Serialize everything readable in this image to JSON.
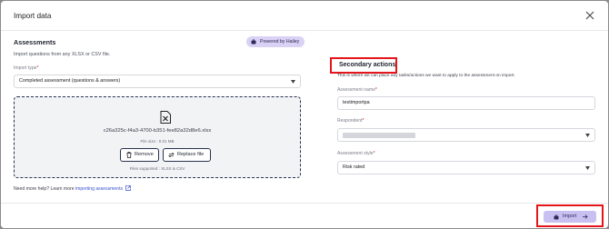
{
  "dialog": {
    "title": "Import data"
  },
  "assessments": {
    "title": "Assessments",
    "badge": "Powered by Hailey",
    "subtitle": "Import questions from any XLSX or CSV file.",
    "import_type_label": "Import type",
    "import_type_value": "Completed assessment (questions & answers)",
    "file": {
      "name": "c26a325c-f4a3-4700-b351-fee82a32d8e6.xlsx",
      "size": "File size : 0.01 MB",
      "remove_label": "Remove",
      "replace_label": "Replace file",
      "supported": "Files supported : XLSX & CSV"
    },
    "help_prefix": "Need more help? Learn more",
    "help_link": "importing assessments"
  },
  "secondary": {
    "title": "Secondary actions",
    "description": "This is where we can place any tasks/actions we want to apply to the assessment on import.",
    "assessment_name_label": "Assessment name",
    "assessment_name_value": "testimportpa",
    "respondent_label": "Respondent",
    "assessment_style_label": "Assessment style",
    "assessment_style_value": "Risk rated"
  },
  "footer": {
    "import_label": "Import"
  },
  "icons": {
    "close": "close-icon",
    "hailey": "hailey-icon",
    "file": "xlsx-file-icon",
    "remove": "trash-icon",
    "replace": "swap-icon",
    "external": "external-link-icon",
    "import": "import-icon",
    "import_arrow": "arrow-right-icon"
  },
  "colors": {
    "accent": "#c8c0f0",
    "badge": "#d9d2f5",
    "highlight": "#e5151b",
    "link": "#3a4fd0"
  }
}
